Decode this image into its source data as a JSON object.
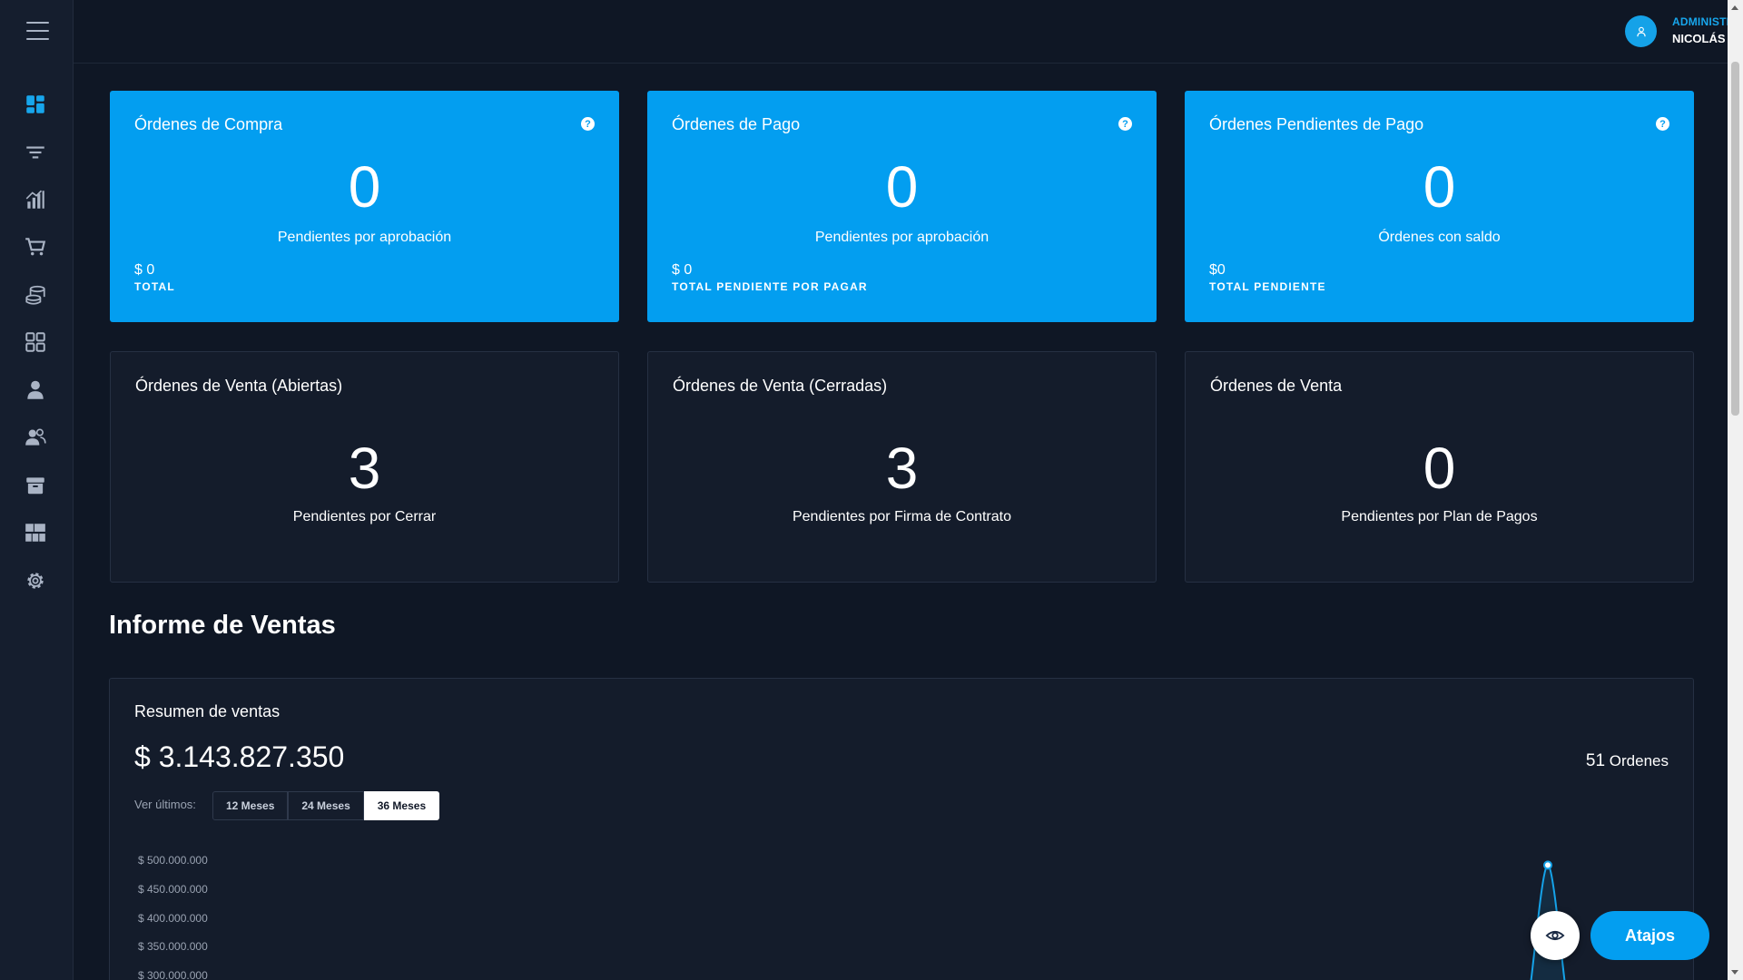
{
  "colors": {
    "accent": "#039ef0",
    "background": "#0f1725",
    "card_dark": "#141c2b"
  },
  "topbar": {
    "menu_icon": "hamburger-icon",
    "user": {
      "role": "ADMINISTRADOR",
      "name": "NICOLÁS",
      "avatar_icon": "user-icon",
      "dropdown_icon": "chevron-down-icon"
    }
  },
  "sidebar": {
    "items": [
      {
        "icon": "dashboard-icon"
      },
      {
        "icon": "filter-icon"
      },
      {
        "icon": "chart-icon"
      },
      {
        "icon": "cart-icon"
      },
      {
        "icon": "coins-icon"
      },
      {
        "icon": "apps-icon"
      },
      {
        "icon": "user-icon"
      },
      {
        "icon": "users-icon"
      },
      {
        "icon": "archive-icon"
      },
      {
        "icon": "grid-icon"
      },
      {
        "icon": "gear-icon"
      }
    ]
  },
  "cards": [
    {
      "title": "Órdenes de Compra",
      "value": "0",
      "subtitle": "Pendientes por aprobación",
      "amount": "$ 0",
      "amount_label": "TOTAL"
    },
    {
      "title": "Órdenes de Pago",
      "value": "0",
      "subtitle": "Pendientes por aprobación",
      "amount": "$ 0",
      "amount_label": "TOTAL PENDIENTE POR PAGAR"
    },
    {
      "title": "Órdenes Pendientes de Pago",
      "value": "0",
      "subtitle": "Órdenes con saldo",
      "amount": "$0",
      "amount_label": "TOTAL PENDIENTE"
    },
    {
      "title": "Órdenes de Venta (Abiertas)",
      "value": "3",
      "subtitle": "Pendientes por Cerrar"
    },
    {
      "title": "Órdenes de Venta (Cerradas)",
      "value": "3",
      "subtitle": "Pendientes por Firma de Contrato"
    },
    {
      "title": "Órdenes de Venta",
      "value": "0",
      "subtitle": "Pendientes por Plan de Pagos"
    }
  ],
  "help_glyph": "?",
  "report": {
    "section_title": "Informe de Ventas",
    "panel_title": "Resumen de ventas",
    "total": "$ 3.143.827.350",
    "orders_count": "51",
    "orders_label": "Ordenes",
    "range_label": "Ver últimos:",
    "ranges": [
      "12 Meses",
      "24 Meses",
      "36 Meses"
    ],
    "active_range": "36 Meses"
  },
  "chart_data": {
    "type": "line",
    "y_ticks": [
      "$ 500.000.000",
      "$ 450.000.000",
      "$ 400.000.000",
      "$ 350.000.000",
      "$ 300.000.000"
    ],
    "series": [
      {
        "points": [
          {
            "x": "latest",
            "y": 490000000
          }
        ]
      }
    ],
    "peak_marker": true
  },
  "floating": {
    "eye_icon": "eye-icon",
    "shortcuts_label": "Atajos"
  }
}
